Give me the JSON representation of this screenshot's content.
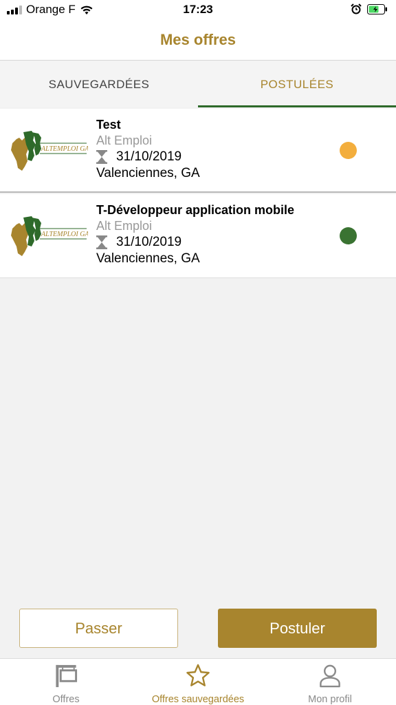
{
  "status_bar": {
    "carrier": "Orange F",
    "time": "17:23"
  },
  "header": {
    "title": "Mes offres"
  },
  "tabs": [
    {
      "label": "SAUVEGARDÉES",
      "active": false
    },
    {
      "label": "POSTULÉES",
      "active": true
    }
  ],
  "offers": [
    {
      "title": "Test",
      "company": "Alt Emploi",
      "date": "31/10/2019",
      "location": "Valenciennes, GA",
      "status_color": "#f3ae3d",
      "logo_text": "ALTEMPLOI GABON"
    },
    {
      "title": "T-Développeur application mobile",
      "company": "Alt Emploi",
      "date": "31/10/2019",
      "location": "Valenciennes, GA",
      "status_color": "#3a7332",
      "logo_text": "ALTEMPLOI GABON"
    }
  ],
  "actions": {
    "pass_label": "Passer",
    "apply_label": "Postuler"
  },
  "bottom_nav": [
    {
      "label": "Offres",
      "icon": "signboard-icon",
      "active": false
    },
    {
      "label": "Offres sauvegardées",
      "icon": "star-icon",
      "active": true
    },
    {
      "label": "Mon profil",
      "icon": "user-icon",
      "active": false
    }
  ],
  "colors": {
    "accent": "#a8852e",
    "tab_indicator": "#2e6a2a"
  }
}
